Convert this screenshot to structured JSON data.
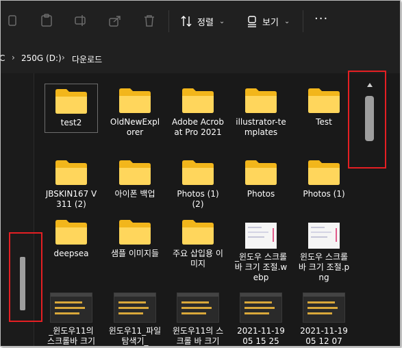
{
  "toolbar": {
    "sort_label": "정렬",
    "view_label": "보기",
    "more_label": "···"
  },
  "address": {
    "crumbs": [
      "C",
      "250G (D:)",
      "다운로드"
    ]
  },
  "items": [
    {
      "label": "test2",
      "kind": "folder",
      "selected": true
    },
    {
      "label": "OldNewExplorer",
      "kind": "folder"
    },
    {
      "label": "Adobe Acrobat Pro 2021",
      "kind": "folder"
    },
    {
      "label": "illustrator-templates",
      "kind": "folder"
    },
    {
      "label": "Test",
      "kind": "folder"
    },
    {
      "label": "JBSKIN167 V311 (2)",
      "kind": "folder"
    },
    {
      "label": "아이폰 백업",
      "kind": "folder"
    },
    {
      "label": "Photos (1) (2)",
      "kind": "folder"
    },
    {
      "label": "Photos",
      "kind": "folder"
    },
    {
      "label": "Photos (1)",
      "kind": "folder"
    },
    {
      "label": "deepsea",
      "kind": "folder"
    },
    {
      "label": "샘플 이미지들",
      "kind": "folder"
    },
    {
      "label": "주요 삽입용 이미지",
      "kind": "folder"
    },
    {
      "label": "_윈도우 스크롤바 크기 조절.webp",
      "kind": "image"
    },
    {
      "label": "윈도우 스크롤바 크기 조절.png",
      "kind": "image"
    },
    {
      "label": "_윈도우11의 스크롤바 크기",
      "kind": "dark-image"
    },
    {
      "label": "윈도우11_파일탐색기_",
      "kind": "dark-image"
    },
    {
      "label": "윈도우11의 스크롤 바 크기",
      "kind": "dark-image"
    },
    {
      "label": "2021-11-19 05 15 25",
      "kind": "dark-image"
    },
    {
      "label": "2021-11-19 05 12 07",
      "kind": "dark-image"
    }
  ],
  "colors": {
    "highlight": "#e51f23",
    "folder_back": "#f2b61b",
    "folder_front": "#ffd65c"
  }
}
